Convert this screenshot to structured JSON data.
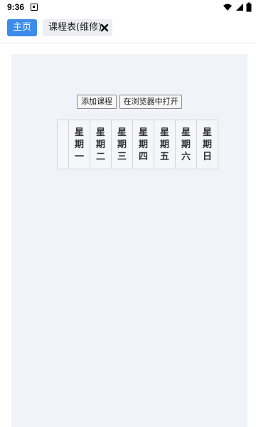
{
  "status_bar": {
    "time": "9:36",
    "icons": [
      "notification-icon",
      "wifi-icon",
      "signal-icon",
      "battery-icon"
    ]
  },
  "tabs": [
    {
      "label": "主页",
      "active": true
    },
    {
      "label": "课程表(维修)",
      "closable": true
    }
  ],
  "toolbar": {
    "add_course_label": "添加课程",
    "open_in_browser_label": "在浏览器中打开"
  },
  "timetable": {
    "days": [
      "星期一",
      "星期二",
      "星期三",
      "星期四",
      "星期五",
      "星期六",
      "星期日"
    ]
  },
  "colors": {
    "accent": "#3d8bea",
    "content_bg": "#f0f3f7",
    "tab_inactive_bg": "#eceef2"
  }
}
